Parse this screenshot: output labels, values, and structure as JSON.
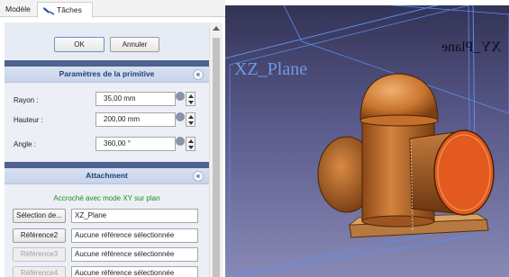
{
  "tabs": {
    "model": "Modèle",
    "tasks": "Tâches"
  },
  "dialog": {
    "ok": "OK",
    "cancel": "Annuler"
  },
  "primitive": {
    "title": "Paramètres de la primitive",
    "collapse_glyph": "«",
    "fields": [
      {
        "label": "Rayon :",
        "value": "35,00 mm"
      },
      {
        "label": "Hauteur :",
        "value": "200,00 mm"
      },
      {
        "label": "Angle :",
        "value": "360,00 °"
      }
    ]
  },
  "attachment": {
    "title": "Attachment",
    "collapse_glyph": "«",
    "status": "Accroché avec mode XY sur plan",
    "refs": [
      {
        "button": "Sélection de...",
        "value": "XZ_Plane",
        "enabled": true
      },
      {
        "button": "Référence2",
        "value": "Aucune référence sélectionnée",
        "enabled": true
      },
      {
        "button": "Référence3",
        "value": "Aucune référence sélectionnée",
        "enabled": false
      },
      {
        "button": "Référence4",
        "value": "Aucune référence sélectionnée",
        "enabled": false
      }
    ]
  },
  "view3d": {
    "label_xz": "XZ_Plane",
    "label_xy": "XY_Plane",
    "plane_color": "#5b8ff0",
    "shape_color": "#c9752f",
    "face_color": "#e25a1f"
  }
}
